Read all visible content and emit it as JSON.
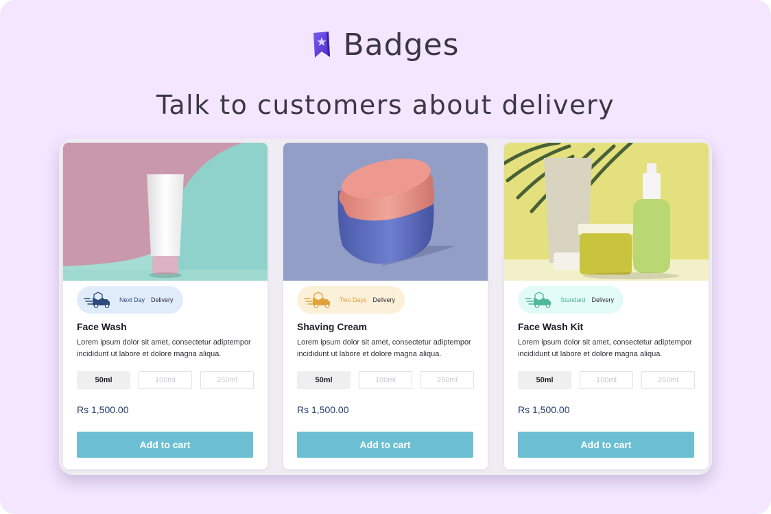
{
  "header": {
    "brand_name": "Badges",
    "headline": "Talk to customers about delivery"
  },
  "colors": {
    "background": "#f3e6fe",
    "button": "#6cbfd3",
    "price": "#1e3a66"
  },
  "cards": [
    {
      "title": "Face Wash",
      "description": "Lorem ipsum dolor sit amet, consectetur adiptempor incididunt ut labore et dolore magna aliqua.",
      "badge": {
        "highlight": "Next Day",
        "rest": "Delivery",
        "icon": "delivery-truck-icon",
        "bg": "#e1ecfb",
        "color": "#2c4a7a"
      },
      "sizes": [
        "50ml",
        "100ml",
        "250ml"
      ],
      "selected_size": "50ml",
      "price": "Rs 1,500.00",
      "button": "Add to cart",
      "image": "white-tube-on-pink-teal-background"
    },
    {
      "title": "Shaving Cream",
      "description": "Lorem ipsum dolor sit amet, consectetur adiptempor incididunt ut labore et dolore magna aliqua.",
      "badge": {
        "highlight": "Two Days",
        "rest": "Delivery",
        "icon": "delivery-truck-icon",
        "bg": "#fbf0d8",
        "color": "#e0a23a"
      },
      "sizes": [
        "50ml",
        "100ml",
        "250ml"
      ],
      "selected_size": "50ml",
      "price": "Rs 1,500.00",
      "button": "Add to cart",
      "image": "blue-jar-with-pink-lid"
    },
    {
      "title": "Face Wash Kit",
      "description": "Lorem ipsum dolor sit amet, consectetur adiptempor incididunt ut labore et dolore magna aliqua.",
      "badge": {
        "highlight": "Standard",
        "rest": "Delivery",
        "icon": "delivery-truck-icon",
        "bg": "#e3fbf6",
        "color": "#4fb89a"
      },
      "sizes": [
        "50ml",
        "100ml",
        "250ml"
      ],
      "selected_size": "50ml",
      "price": "Rs 1,500.00",
      "button": "Add to cart",
      "image": "cosmetic-kit-with-palm-leaves"
    }
  ]
}
